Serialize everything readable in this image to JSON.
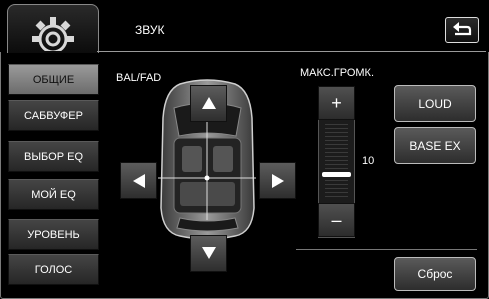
{
  "header": {
    "title": "ЗВУК",
    "settings_icon": "gear-icon",
    "back_icon": "back-arrow-icon"
  },
  "menu": [
    {
      "label": "ОБЩИЕ",
      "active": true
    },
    {
      "label": "САБВУФЕР",
      "active": false
    },
    {
      "label": "ВЫБОР EQ",
      "active": false
    },
    {
      "label": "МОЙ EQ",
      "active": false
    },
    {
      "label": "УРОВЕНЬ",
      "active": false
    },
    {
      "label": "ГОЛОС",
      "active": false
    }
  ],
  "balance": {
    "label": "BAL/FAD",
    "up_icon": "arrow-up-icon",
    "down_icon": "arrow-down-icon",
    "left_icon": "arrow-left-icon",
    "right_icon": "arrow-right-icon"
  },
  "volume": {
    "label": "МАКС.ГРОМК.",
    "plus": "+",
    "minus": "–",
    "value": "10",
    "level": 0.5
  },
  "buttons": {
    "loud": "LOUD",
    "base_ex": "BASE EX",
    "reset": "Сброс"
  }
}
